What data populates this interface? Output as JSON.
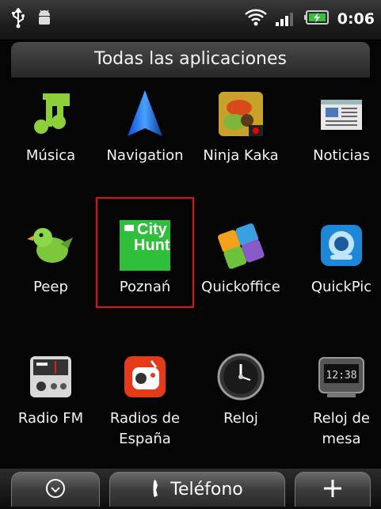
{
  "status": {
    "time": "0:06"
  },
  "header": {
    "title": "Todas las aplicaciones"
  },
  "apps": [
    {
      "label": "Música",
      "icon": "music-icon"
    },
    {
      "label": "Navigation",
      "icon": "navigation-icon"
    },
    {
      "label": "Ninja Kaka",
      "icon": "ninja-kaka-icon"
    },
    {
      "label": "Noticias",
      "icon": "news-icon"
    },
    {
      "label": "Peep",
      "icon": "peep-bird-icon"
    },
    {
      "label": "Poznań",
      "icon": "city-hunt-icon",
      "icon_text_top": "City",
      "icon_text_bottom": "Hunt"
    },
    {
      "label": "Quickoffice",
      "icon": "quickoffice-icon"
    },
    {
      "label": "QuickPic",
      "icon": "quickpic-icon"
    },
    {
      "label": "Radio FM",
      "icon": "radio-fm-icon"
    },
    {
      "label": "Radios de España",
      "icon": "radios-espana-icon"
    },
    {
      "label": "Reloj",
      "icon": "clock-icon"
    },
    {
      "label": "Reloj de mesa",
      "icon": "desk-clock-icon",
      "icon_text": "12:38"
    }
  ],
  "dock": {
    "phone_label": "Teléfono"
  },
  "colors": {
    "highlight": "#e01010",
    "city_hunt_green": "#2fbf3a"
  }
}
